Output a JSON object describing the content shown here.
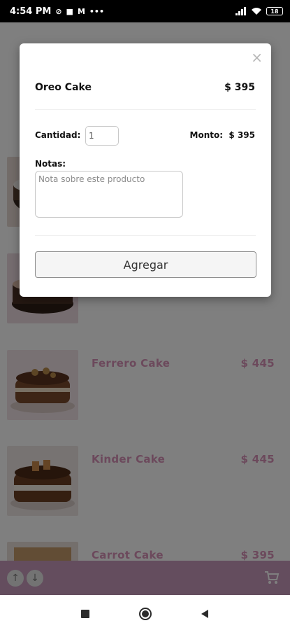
{
  "status_bar": {
    "time": "4:54 PM",
    "left_icons": [
      "sync-off-icon",
      "lock-icon",
      "gmail-icon",
      "more-icon"
    ],
    "battery": "18"
  },
  "products": [
    {
      "name": "Ferrero Cake",
      "price": "$ 445",
      "image": "ferrero-cake-photo"
    },
    {
      "name": "Kinder Cake",
      "price": "$ 445",
      "image": "kinder-cake-photo"
    },
    {
      "name": "Carrot Cake",
      "price": "$ 395",
      "image": "carrot-cake-photo"
    }
  ],
  "bottom_bar": {
    "up_icon": "arrow-up-icon",
    "down_icon": "arrow-down-icon",
    "cart_icon": "cart-icon"
  },
  "modal": {
    "close_symbol": "×",
    "title": "Oreo Cake",
    "price": "$ 395",
    "quantity_label": "Cantidad:",
    "quantity_value": "1",
    "amount_text": "Monto:  $ 395",
    "notes_label": "Notas:",
    "notes_placeholder": "Nota sobre este producto",
    "add_button": "Agregar"
  },
  "nav": {
    "items": [
      "recents-square-icon",
      "home-circle-icon",
      "back-triangle-icon"
    ]
  },
  "colors": {
    "accent": "#c89bbd",
    "product_text": "#d892b8"
  }
}
